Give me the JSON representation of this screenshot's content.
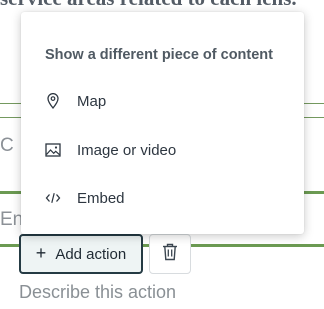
{
  "background": {
    "heading_fragment": "service areas related to each lens.",
    "cut_text_1": "C",
    "cut_text_2": "Env",
    "add_action_label": "Add action",
    "describe_placeholder": "Describe this action"
  },
  "popover": {
    "title": "Show a different piece of content",
    "items": [
      {
        "label": "Map",
        "icon": "map-pin-icon"
      },
      {
        "label": "Image or video",
        "icon": "image-icon"
      },
      {
        "label": "Embed",
        "icon": "code-icon"
      }
    ]
  },
  "colors": {
    "accent_green": "#6b9a52",
    "button_border": "#253b44",
    "button_fill": "#eef4f4",
    "text_dark": "#2d3640",
    "title_gray": "#505a63"
  }
}
